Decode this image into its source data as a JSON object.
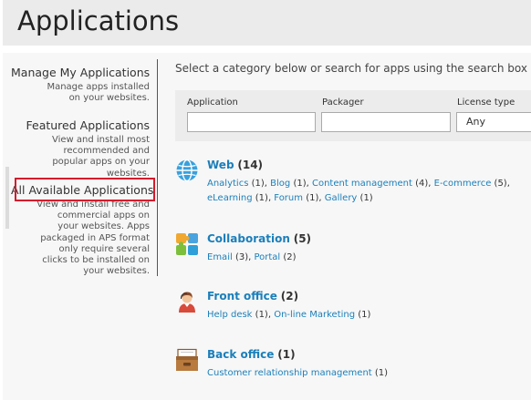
{
  "page": {
    "title": "Applications"
  },
  "sidebar": {
    "items": [
      {
        "title": "Manage My Applications",
        "desc": "Manage apps installed on your websites."
      },
      {
        "title": "Featured Applications",
        "desc": "View and install most recommended and popular apps on your websites."
      },
      {
        "title": "All Available Applications",
        "desc": "View and install free and commercial apps on your websites. Apps packaged in APS format only require several clicks to be installed on your websites.",
        "selected": true
      }
    ]
  },
  "main": {
    "hint": "Select a category below or search for apps using the search box",
    "filters": {
      "application_label": "Application",
      "application_value": "",
      "packager_label": "Packager",
      "packager_value": "",
      "license_label": "License type",
      "license_value": "Any"
    },
    "categories": [
      {
        "name": "Web",
        "count": "(14)",
        "icon": "globe-icon",
        "links": [
          {
            "label": "Analytics",
            "count": "(1)"
          },
          {
            "label": "Blog",
            "count": "(1)"
          },
          {
            "label": "Content management",
            "count": "(4)"
          },
          {
            "label": "E-commerce",
            "count": "(5)"
          },
          {
            "label": "eLearning",
            "count": "(1)"
          },
          {
            "label": "Forum",
            "count": "(1)"
          },
          {
            "label": "Gallery",
            "count": "(1)"
          }
        ]
      },
      {
        "name": "Collaboration",
        "count": "(5)",
        "icon": "puzzle-icon",
        "links": [
          {
            "label": "Email",
            "count": "(3)"
          },
          {
            "label": "Portal",
            "count": "(2)"
          }
        ]
      },
      {
        "name": "Front office",
        "count": "(2)",
        "icon": "receptionist-icon",
        "links": [
          {
            "label": "Help desk",
            "count": "(1)"
          },
          {
            "label": "On-line Marketing",
            "count": "(1)"
          }
        ]
      },
      {
        "name": "Back office",
        "count": "(1)",
        "icon": "archive-box-icon",
        "links": [
          {
            "label": "Customer relationship management",
            "count": "(1)"
          }
        ]
      }
    ]
  },
  "colors": {
    "link": "#1b7fba",
    "selected_border": "#d41c2c",
    "title_bar": "#ebebeb"
  }
}
